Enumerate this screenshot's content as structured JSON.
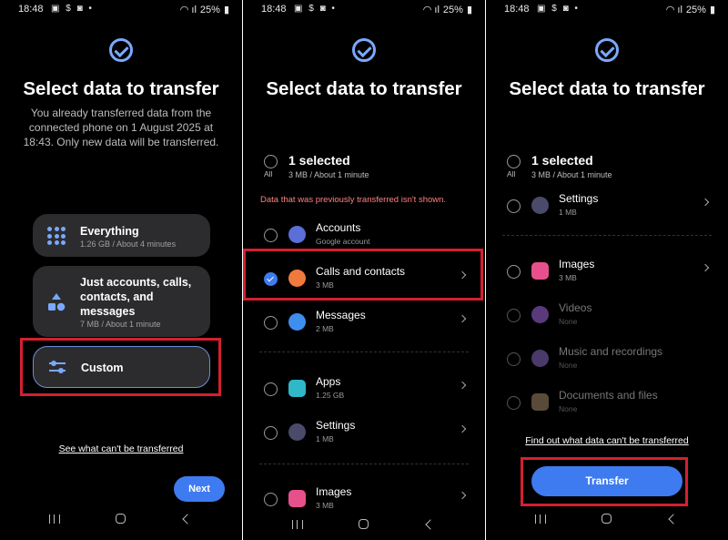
{
  "status": {
    "time": "18:48",
    "battery": "25%"
  },
  "screen1": {
    "title": "Select data to transfer",
    "subtitle": "You already transferred data from the connected phone on 1 August 2025 at 18:43. Only new data will be transferred.",
    "options": [
      {
        "title": "Everything",
        "sub": "1.26 GB / About 4 minutes"
      },
      {
        "title": "Just accounts, calls, contacts, and messages",
        "sub": "7 MB / About 1 minute"
      },
      {
        "title": "Custom"
      }
    ],
    "link": "See what can't be transferred",
    "next": "Next"
  },
  "screen2": {
    "title": "Select data to transfer",
    "selected": "1 selected",
    "selected_sub": "3 MB / About 1 minute",
    "all": "All",
    "notice": "Data that was previously transferred isn't shown.",
    "items": [
      {
        "title": "Accounts",
        "sub": "Google account"
      },
      {
        "title": "Calls and contacts",
        "sub": "3 MB"
      },
      {
        "title": "Messages",
        "sub": "2 MB"
      },
      {
        "title": "Apps",
        "sub": "1.25 GB"
      },
      {
        "title": "Settings",
        "sub": "1 MB"
      },
      {
        "title": "Images",
        "sub": "3 MB"
      }
    ]
  },
  "screen3": {
    "title": "Select data to transfer",
    "selected": "1 selected",
    "selected_sub": "3 MB / About 1 minute",
    "all": "All",
    "items": [
      {
        "title": "Settings",
        "sub": "1 MB"
      },
      {
        "title": "Images",
        "sub": "3 MB"
      },
      {
        "title": "Videos",
        "sub": "None"
      },
      {
        "title": "Music and recordings",
        "sub": "None"
      },
      {
        "title": "Documents and files",
        "sub": "None"
      }
    ],
    "link": "Find out what data can't be transferred",
    "transfer": "Transfer"
  },
  "colors": {
    "accent": "#3e7bf0",
    "highlight": "#d32030",
    "notice": "#ff8080"
  }
}
